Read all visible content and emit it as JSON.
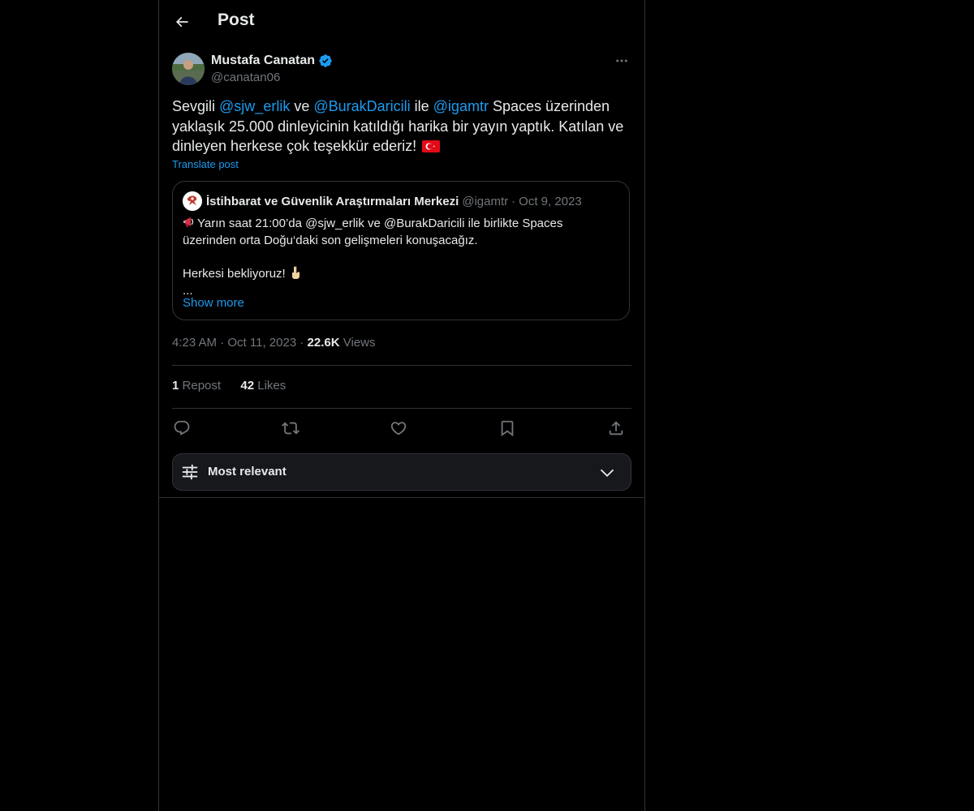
{
  "header": {
    "title": "Post",
    "back_icon": "arrow-left-icon"
  },
  "author": {
    "name": "Mustafa Canatan",
    "handle": "@canatan06",
    "verified": true,
    "verified_color": "#1d9bf0"
  },
  "post": {
    "segments": [
      {
        "text": "Sevgili ",
        "type": "text"
      },
      {
        "text": "@sjw_erlik",
        "type": "mention"
      },
      {
        "text": "  ve ",
        "type": "text"
      },
      {
        "text": "@BurakDaricili",
        "type": "mention"
      },
      {
        "text": " ile ",
        "type": "text"
      },
      {
        "text": "@igamtr",
        "type": "mention"
      },
      {
        "text": "  Spaces üzerinden yaklaşık 25.000 dinleyicinin katıldığı harika bir yayın yaptık. Katılan ve dinleyen herkese çok teşekkür ederiz!",
        "type": "text"
      }
    ],
    "flag_emoji": "turkey-flag",
    "translate_label": "Translate post"
  },
  "quote": {
    "name": "İstihbarat ve Güvenlik Araştırmaları Merkezi",
    "handle": "@igamtr",
    "dot": "·",
    "date": "Oct 9, 2023",
    "line1_emoji": "megaphone-icon",
    "line1": "Yarın saat 21:00’da @sjw_erlik ve @BurakDaricili  ile birlikte Spaces",
    "line2": "üzerinden orta Doğu‘daki son gelişmeleri konuşacağız.",
    "line3": "Herkesi bekliyoruz! ",
    "line3_emoji": "pointing-down-icon",
    "line4": "...",
    "show_more": "Show more"
  },
  "meta": {
    "time": "4:23 AM",
    "sep": "·",
    "date": "Oct 11, 2023",
    "views_count": "22.6K",
    "views_label": "Views"
  },
  "stats": {
    "reposts_count": "1",
    "reposts_label": "Repost",
    "likes_count": "42",
    "likes_label": "Likes"
  },
  "actions": [
    "reply-icon",
    "repost-icon",
    "like-icon",
    "bookmark-icon",
    "share-icon"
  ],
  "sort": {
    "label": "Most relevant"
  },
  "colors": {
    "background": "#000000",
    "text": "#e7e9ea",
    "secondary": "#71767b",
    "accent": "#1d9bf0",
    "border": "#2f3336"
  }
}
